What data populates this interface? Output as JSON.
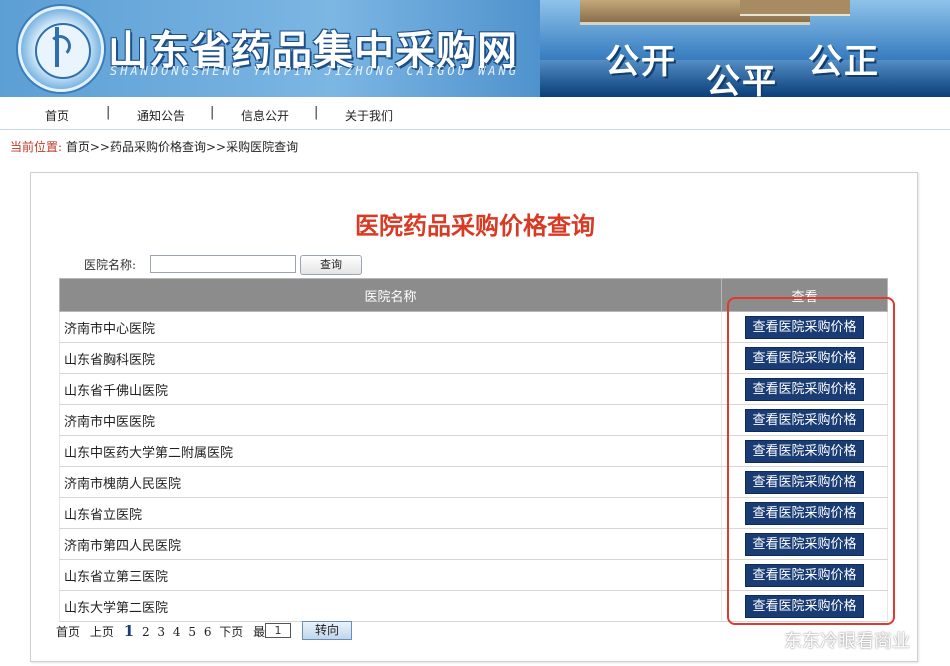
{
  "header": {
    "site_title": "山东省药品集中采购网",
    "site_pinyin": "SHANDONGSHENG YAOPIN JIZHONG CAIGOU WANG",
    "slogans": [
      "公开",
      "公平",
      "公正"
    ]
  },
  "nav": {
    "items": [
      {
        "label": "首页"
      },
      {
        "label": "通知公告"
      },
      {
        "label": "信息公开"
      },
      {
        "label": "关于我们"
      }
    ],
    "separator": "|"
  },
  "breadcrumb": {
    "label": "当前位置:",
    "path": "首页>>药品采购价格查询>>采购医院查询"
  },
  "page": {
    "heading": "医院药品采购价格查询"
  },
  "search": {
    "label": "医院名称:",
    "value": "",
    "button": "查询"
  },
  "table": {
    "columns": [
      "医院名称",
      "查看"
    ],
    "action_label": "查看医院采购价格",
    "rows": [
      {
        "name": "济南市中心医院"
      },
      {
        "name": "山东省胸科医院"
      },
      {
        "name": "山东省千佛山医院"
      },
      {
        "name": "济南市中医医院"
      },
      {
        "name": "山东中医药大学第二附属医院"
      },
      {
        "name": "济南市槐荫人民医院"
      },
      {
        "name": "山东省立医院"
      },
      {
        "name": "济南市第四人民医院"
      },
      {
        "name": "山东省立第三医院"
      },
      {
        "name": "山东大学第二医院"
      }
    ]
  },
  "pager": {
    "first": "首页",
    "prev": "上页",
    "current": "1",
    "pages": [
      "2",
      "3",
      "4",
      "5",
      "6"
    ],
    "next": "下页",
    "last": "最后",
    "page_input": "1",
    "go": "转向"
  },
  "watermark": "东东冷眼看商业",
  "colors": {
    "heading": "#d83a24",
    "button_bg": "#1a3c74",
    "table_header_bg": "#8c8c8c",
    "highlight_border": "#e03a2f"
  }
}
